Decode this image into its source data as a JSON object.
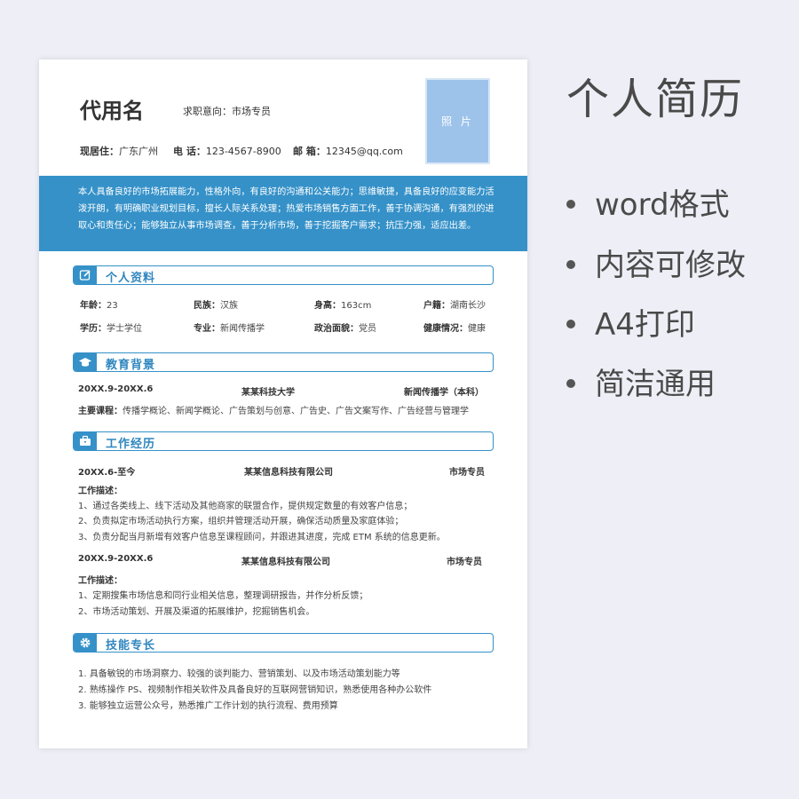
{
  "resume": {
    "name": "代用名",
    "intent": "求职意向：市场专员",
    "photo_label": "照 片",
    "contact": {
      "residence_label": "现居住：",
      "residence": "广东广州",
      "phone_label": "电 话：",
      "phone": "123-4567-8900",
      "email_label": "邮 箱：",
      "email": "12345@qq.com"
    },
    "summary_lines": [
      "本人具备良好的市场拓展能力，性格外向，有良好的沟通和公关能力；思维敏捷，具备良好的应变能力活",
      "泼开朗，有明确职业规划目标，擅长人际关系处理；热爱市场销售方面工作，善于协调沟通，有强烈的进",
      "取心和责任心；能够独立从事市场调查，善于分析市场，善于挖掘客户需求；抗压力强，适应出差。"
    ],
    "sections": {
      "profile": "个人资料",
      "education": "教育背景",
      "work": "工作经历",
      "skills": "技能专长"
    },
    "profile": {
      "age_label": "年龄：",
      "age": "23",
      "ethnicity_label": "民族：",
      "ethnicity": "汉族",
      "height_label": "身高：",
      "height": "163cm",
      "hukou_label": "户籍：",
      "hukou": "湖南长沙",
      "degree_label": "学历：",
      "degree": "学士学位",
      "major_label": "专业：",
      "major": "新闻传播学",
      "political_label": "政治面貌：",
      "political": "党员",
      "health_label": "健康情况：",
      "health": "健康"
    },
    "education": {
      "period": "20XX.9-20XX.6",
      "school": "某某科技大学",
      "major": "新闻传播学（本科）",
      "courses_label": "主要课程：",
      "courses": "传播学概论、新闻学概论、广告策划与创意、广告史、广告文案写作、广告经营与管理学"
    },
    "work": [
      {
        "period": "20XX.6-至今",
        "company": "某某信息科技有限公司",
        "role": "市场专员",
        "desc_label": "工作描述：",
        "items": [
          "1、通过各类线上、线下活动及其他商家的联盟合作，提供规定数量的有效客户信息；",
          "2、负责拟定市场活动执行方案，组织并管理活动开展，确保活动质量及家庭体验；",
          "3、负责分配当月新增有效客户信息至课程顾问，并跟进其进度，完成 ETM 系统的信息更新。"
        ]
      },
      {
        "period": "20XX.9-20XX.6",
        "company": "某某信息科技有限公司",
        "role": "市场专员",
        "desc_label": "工作描述：",
        "items": [
          "1、定期搜集市场信息和同行业相关信息，整理调研报告，并作分析反馈；",
          "2、市场活动策划、开展及渠道的拓展维护，挖掘销售机会。"
        ]
      }
    ],
    "skills": [
      "1.    具备敏锐的市场洞察力、较强的谈判能力、营销策划、以及市场活动策划能力等",
      "2.    熟练操作 PS、视频制作相关软件及具备良好的互联网营销知识，熟悉使用各种办公软件",
      "3.    能够独立运营公众号，熟悉推广工作计划的执行流程、费用预算"
    ]
  },
  "side": {
    "title": "个人简历",
    "bullets": [
      "word格式",
      "内容可修改",
      "A4打印",
      "简洁通用"
    ]
  },
  "colors": {
    "accent": "#3591c8",
    "photo": "#9dc3ea",
    "background": "#eeeef6"
  },
  "icons": [
    "edit-icon",
    "graduation-cap-icon",
    "briefcase-icon",
    "gear-icon"
  ]
}
